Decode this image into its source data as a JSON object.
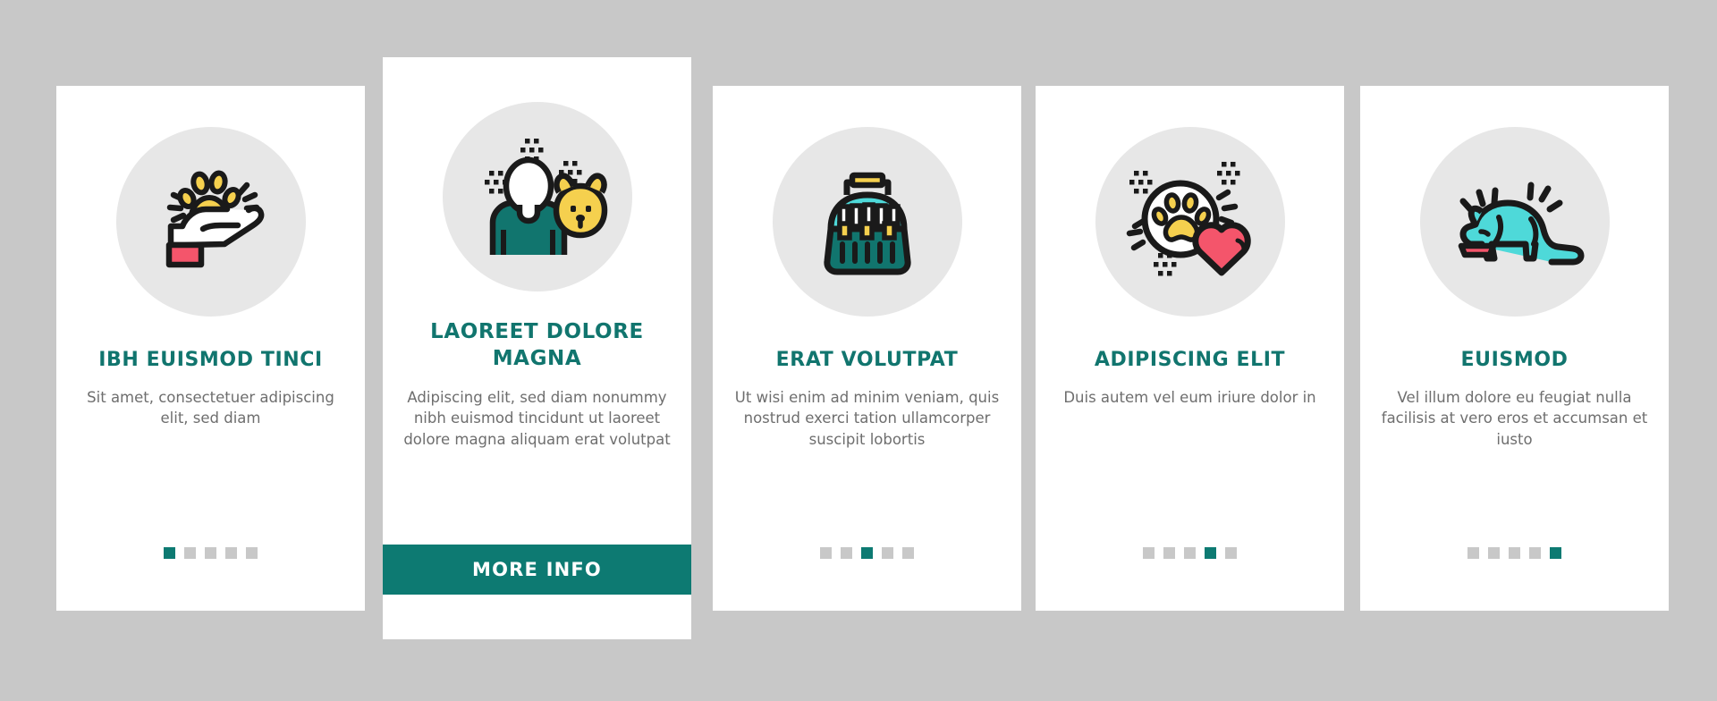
{
  "theme": {
    "background": "#c8c8c8",
    "card_background": "#ffffff",
    "accent_teal": "#0d7a72",
    "title_teal": "#11756e",
    "body_text": "#6e6e6e",
    "icon_circle": "#e7e7e7",
    "dot_inactive": "#c8c8c8",
    "icon_yellow": "#f5d04e",
    "icon_pink": "#f4556b",
    "icon_cyan": "#4ed9d9",
    "icon_outline": "#1a1a1a"
  },
  "cards": [
    {
      "icon_name": "hand-holding-paw-icon",
      "title": "IBH EUISMOD TINCI",
      "description": "Sit amet, consectetuer adipiscing elit, sed diam",
      "dots": {
        "count": 5,
        "active_index": 0
      },
      "featured": false,
      "cta_label": ""
    },
    {
      "icon_name": "person-with-dog-icon",
      "title": "LAOREET DOLORE MAGNA",
      "description": "Adipiscing elit, sed diam nonummy nibh euismod tincidunt ut laoreet dolore magna aliquam erat volutpat",
      "dots": {
        "count": 0,
        "active_index": -1
      },
      "featured": true,
      "cta_label": "MORE INFO"
    },
    {
      "icon_name": "pet-carrier-icon",
      "title": "ERAT VOLUTPAT",
      "description": "Ut wisi enim ad minim veniam, quis nostrud exerci tation ullamcorper suscipit lobortis",
      "dots": {
        "count": 5,
        "active_index": 2
      },
      "featured": false,
      "cta_label": ""
    },
    {
      "icon_name": "paw-heart-icon",
      "title": "ADIPISCING ELIT",
      "description": "Duis autem vel eum iriure dolor in",
      "dots": {
        "count": 5,
        "active_index": 3
      },
      "featured": false,
      "cta_label": ""
    },
    {
      "icon_name": "cat-eating-icon",
      "title": "EUISMOD",
      "description": "Vel illum dolore eu feugiat nulla facilisis at vero eros et accumsan et iusto",
      "dots": {
        "count": 5,
        "active_index": 4
      },
      "featured": false,
      "cta_label": ""
    }
  ]
}
